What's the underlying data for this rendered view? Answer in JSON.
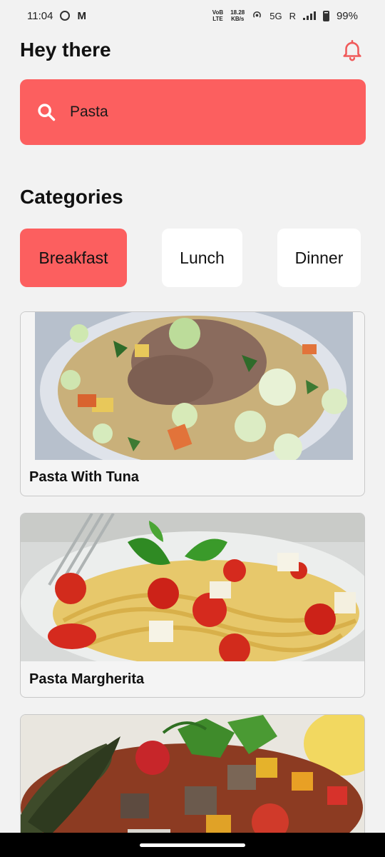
{
  "status_bar": {
    "time": "11:04",
    "volte": "VoB",
    "lte": "LTE",
    "speed_value": "18.28",
    "speed_unit": "KB/s",
    "network": "5G",
    "roaming": "R",
    "battery": "99%"
  },
  "header": {
    "greeting": "Hey there",
    "bell_icon": "bell-icon"
  },
  "search": {
    "value": "Pasta",
    "icon": "search-icon"
  },
  "categories": {
    "title": "Categories",
    "items": [
      {
        "label": "Breakfast",
        "active": true
      },
      {
        "label": "Lunch",
        "active": false
      },
      {
        "label": "Dinner",
        "active": false
      }
    ]
  },
  "recipes": [
    {
      "title": "Pasta With Tuna"
    },
    {
      "title": "Pasta Margherita"
    },
    {
      "title": ""
    }
  ],
  "colors": {
    "accent": "#fc5f5f",
    "background": "#f2f2f2",
    "card_background": "#f4f4f4"
  }
}
